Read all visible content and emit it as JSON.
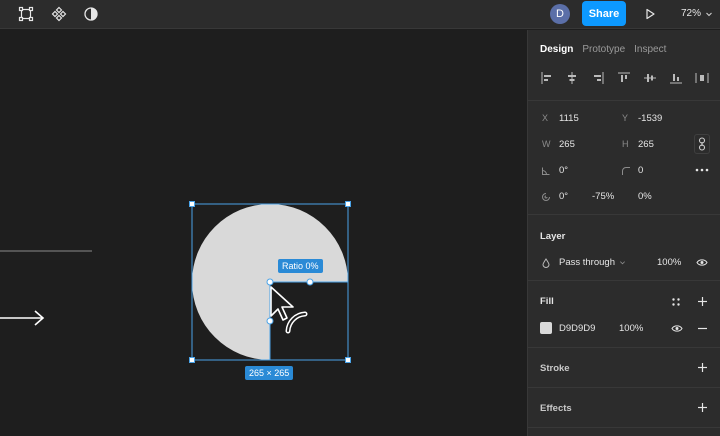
{
  "toolbar": {
    "frame_icon": "frame-icon",
    "component_icon": "component-icon",
    "contrast_icon": "contrast-icon",
    "avatar_initial": "D",
    "share_label": "Share",
    "play_icon": "play-icon",
    "zoom_label": "72%"
  },
  "canvas": {
    "ratio_label": "Ratio 0%",
    "size_label": "265 × 265",
    "shape_fill": "#d9d9d9",
    "selection_color": "#4aa3e8"
  },
  "panel": {
    "tabs": [
      {
        "label": "Design",
        "active": true
      },
      {
        "label": "Prototype",
        "active": false
      },
      {
        "label": "Inspect",
        "active": false
      }
    ],
    "position": {
      "x_label": "X",
      "x_value": "1115",
      "y_label": "Y",
      "y_value": "-1539",
      "w_label": "W",
      "w_value": "265",
      "h_label": "H",
      "h_value": "265"
    },
    "rotation_value": "0°",
    "corner_radius_value": "0",
    "arc": {
      "start": "0°",
      "sweep": "-75%",
      "ratio": "0%"
    },
    "layer": {
      "title": "Layer",
      "blend_mode": "Pass through",
      "opacity": "100%"
    },
    "fill": {
      "title": "Fill",
      "hex": "D9D9D9",
      "opacity": "100%",
      "color": "#d9d9d9"
    },
    "stroke": {
      "title": "Stroke"
    },
    "effects": {
      "title": "Effects"
    }
  }
}
